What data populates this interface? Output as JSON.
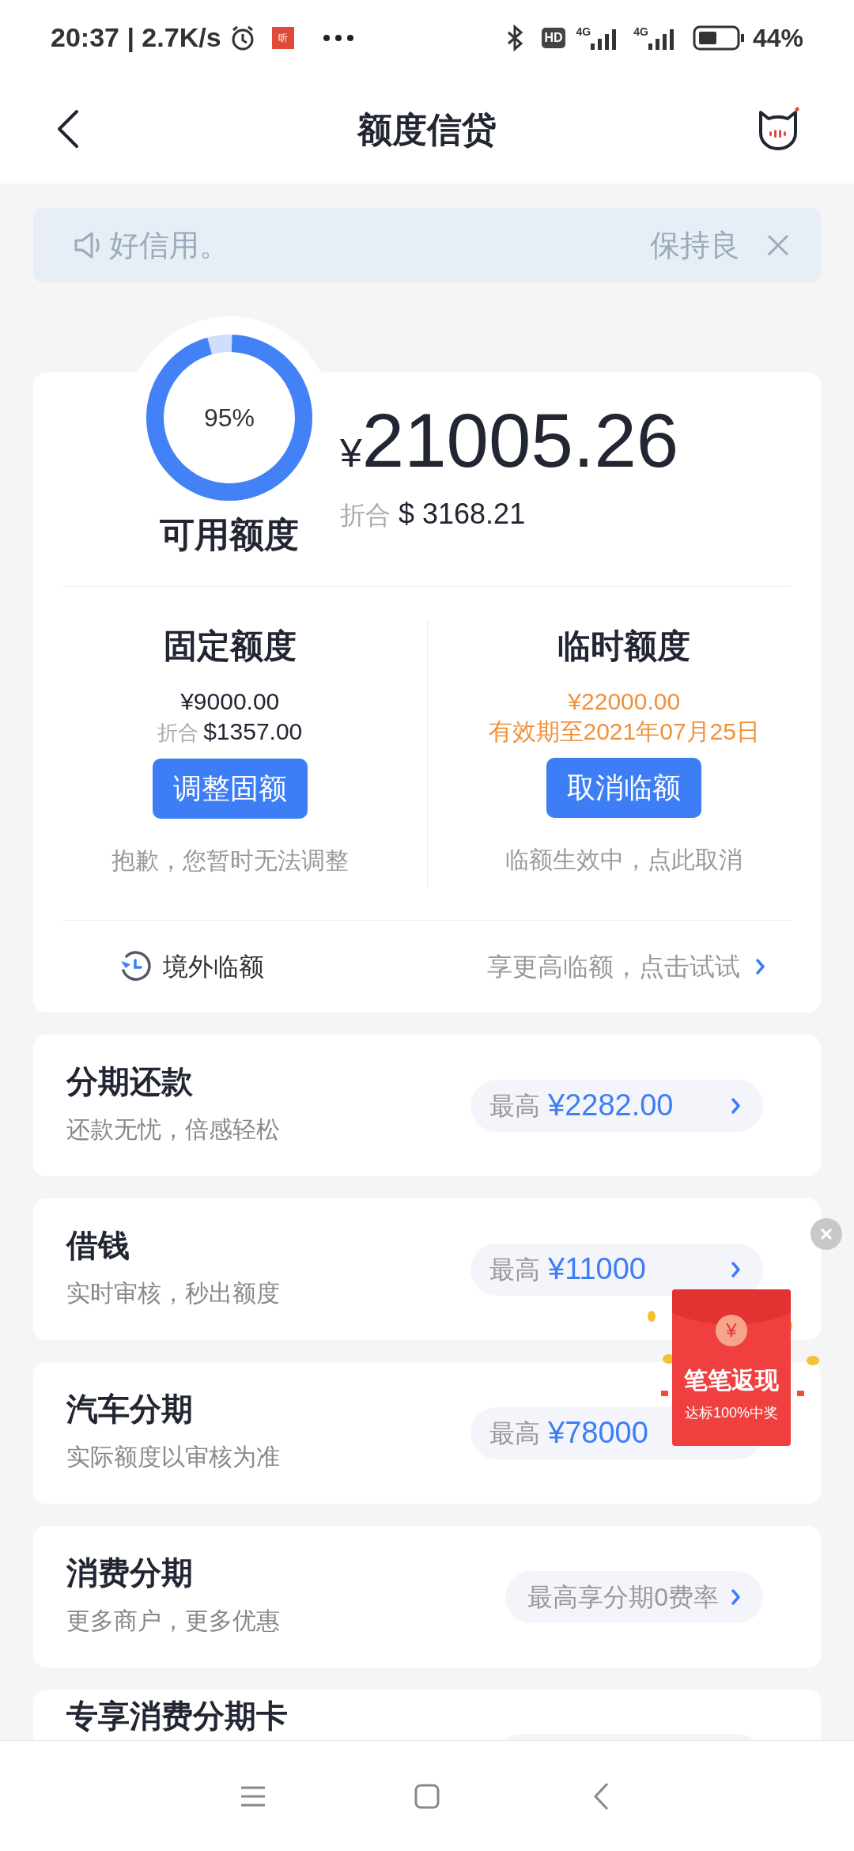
{
  "status_bar": {
    "time": "20:37 | 2.7K/s",
    "app_badge": "听",
    "hd": "HD",
    "network_1": "4G",
    "network_2": "4G",
    "battery": "44%"
  },
  "header": {
    "title": "额度信贷"
  },
  "notice": {
    "text_left": "好信用。",
    "text_right": "保持良"
  },
  "credit": {
    "ring": {
      "label": "95%"
    },
    "label": "可用额度",
    "currency": "¥",
    "amount": "21005.26",
    "converted_label": "折合",
    "converted_amount": "$ 3168.21"
  },
  "limits": [
    {
      "title": "固定额度",
      "amount": "¥9000.00",
      "converted_label": "折合",
      "converted_amount": "$1357.00",
      "highlight": false,
      "button": "调整固额",
      "note": "抱歉，您暂时无法调整"
    },
    {
      "title": "临时额度",
      "amount": "¥22000.00",
      "validity": "有效期至2021年07月25日",
      "highlight": true,
      "button": "取消临额",
      "note": "临额生效中，点此取消"
    }
  ],
  "overseas": {
    "label": "境外临额",
    "action": "享更高临额，点击试试"
  },
  "services": [
    {
      "title": "分期还款",
      "subtitle": "还款无忧，倍感轻松",
      "pill": {
        "kind": "amount",
        "prefix": "最高",
        "amount": "¥2282.00",
        "arrow": true
      }
    },
    {
      "title": "借钱",
      "subtitle": "实时审核，秒出额度",
      "pill": {
        "kind": "amount",
        "prefix": "最高",
        "amount": "¥11000",
        "arrow": true
      }
    },
    {
      "title": "汽车分期",
      "subtitle": "实际额度以审核为准",
      "pill": {
        "kind": "amount",
        "prefix": "最高",
        "amount": "¥78000",
        "arrow": false
      }
    },
    {
      "title": "消费分期",
      "subtitle": "更多商户，更多优惠",
      "pill": {
        "kind": "text",
        "text": "最高享分期0费率"
      }
    },
    {
      "title": "专享消费分期卡",
      "pill": {
        "kind": "blank"
      }
    }
  ],
  "promo": {
    "coin": "¥",
    "title": "笔笔返现",
    "subtitle": "达标100%中奖"
  }
}
